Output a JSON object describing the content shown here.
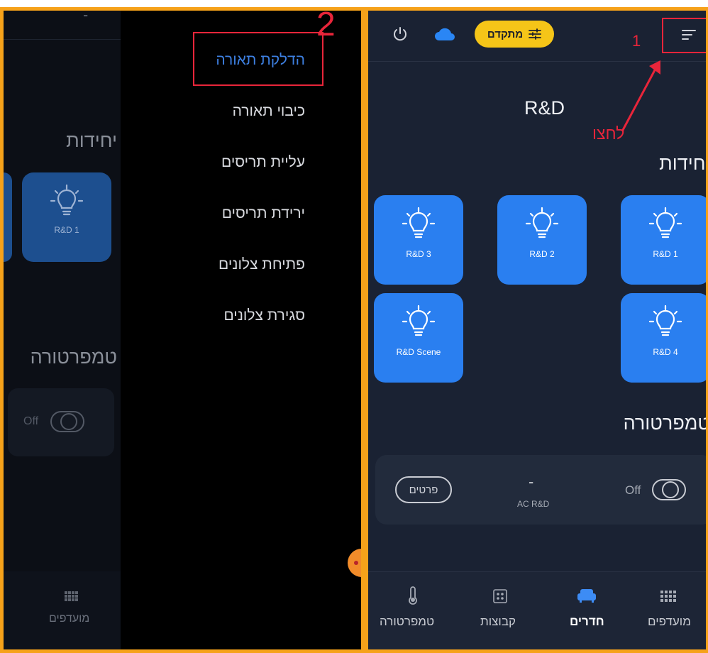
{
  "left_panel": {
    "drawer_title_dash": "-",
    "menu_items": [
      "הדלקת תאורה",
      "כיבוי תאורה",
      "עליית תריסים",
      "ירידת תריסים",
      "פתיחת צלונים",
      "סגירת צלונים"
    ],
    "annotation_number": "2",
    "units_title": "יחידות",
    "tile_label": "R&D 1",
    "temperature_title": "טמפרטורה",
    "toggle_label": "Off",
    "nav_label": "מועדפים"
  },
  "right_panel": {
    "advanced_label": "מתקדם",
    "annotation_number": "1",
    "annotation_text": "לחצו",
    "page_title": "R&D",
    "units_title": "יחידות",
    "tiles": [
      "R&D 1",
      "R&D 2",
      "R&D 3",
      "R&D 4",
      "R&D Scene"
    ],
    "temperature_title": "טמפרטורה",
    "ac": {
      "toggle_label": "Off",
      "value": "-",
      "name": "AC R&D",
      "details_button": "פרטים"
    },
    "nav": [
      "מועדפים",
      "חדרים",
      "קבוצות",
      "טמפרטורה"
    ]
  },
  "colors": {
    "frame": "#f6a21a",
    "accent": "#2a7ff0",
    "annotation": "#e8253a",
    "advanced_pill": "#f5c518"
  }
}
